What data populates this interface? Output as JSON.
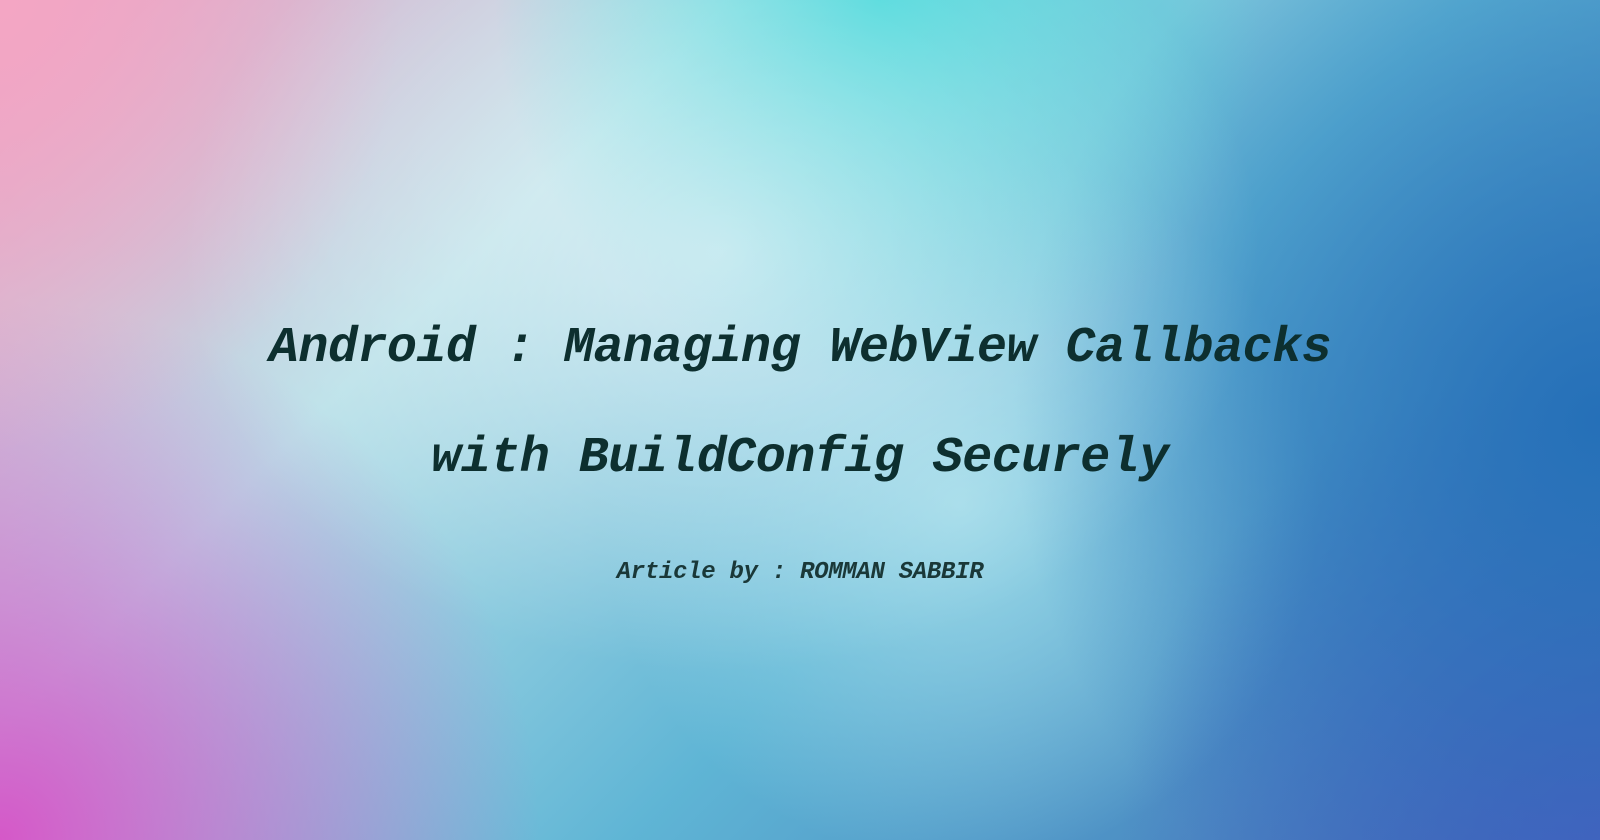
{
  "title": {
    "line1": "Android : Managing WebView Callbacks",
    "line2": "with BuildConfig Securely"
  },
  "byline": "Article by : ROMMAN SABBIR",
  "colors": {
    "text": "#0d2f2f",
    "gradient_pink": "#f4a6c4",
    "gradient_cyan": "#3dd5d8",
    "gradient_blue": "#2570b8",
    "gradient_magenta": "#d558c8",
    "gradient_purple": "#4a5fc1"
  }
}
